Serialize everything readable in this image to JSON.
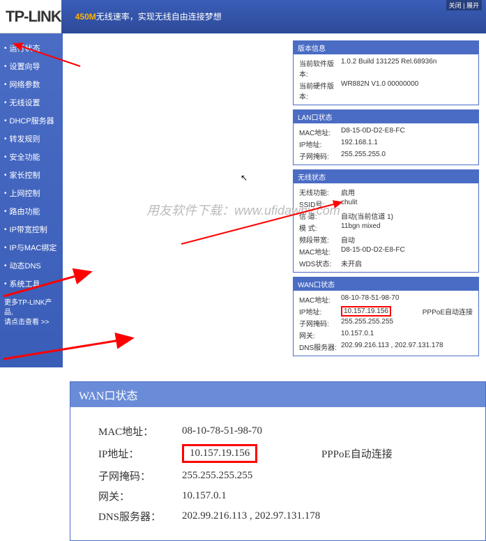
{
  "header": {
    "logo": "TP-LINK",
    "banner_highlight": "450M",
    "banner_text": "无线速率，实现无线自由连接梦想",
    "browser_menu": "关闭 | 展开"
  },
  "sidebar": {
    "items": [
      {
        "label": "运行状态"
      },
      {
        "label": "设置向导"
      },
      {
        "label": "网络参数"
      },
      {
        "label": "无线设置"
      },
      {
        "label": "DHCP服务器"
      },
      {
        "label": "转发规则"
      },
      {
        "label": "安全功能"
      },
      {
        "label": "家长控制"
      },
      {
        "label": "上网控制"
      },
      {
        "label": "路由功能"
      },
      {
        "label": "IP带宽控制"
      },
      {
        "label": "IP与MAC绑定"
      },
      {
        "label": "动态DNS"
      },
      {
        "label": "系统工具"
      }
    ],
    "footer_line1": "更多TP-LINK产品,",
    "footer_line2": "请点击查看 >>"
  },
  "panels": {
    "version": {
      "title": "版本信息",
      "rows": [
        {
          "label": "当前软件版本:",
          "value": "1.0.2 Build 131225 Rel.68936n"
        },
        {
          "label": "当前硬件版本:",
          "value": "WR882N V1.0 00000000"
        }
      ]
    },
    "lan": {
      "title": "LAN口状态",
      "rows": [
        {
          "label": "MAC地址:",
          "value": "D8-15-0D-D2-E8-FC"
        },
        {
          "label": "IP地址:",
          "value": "192.168.1.1"
        },
        {
          "label": "子网掩码:",
          "value": "255.255.255.0"
        }
      ]
    },
    "wireless": {
      "title": "无线状态",
      "rows": [
        {
          "label": "无线功能:",
          "value": "启用"
        },
        {
          "label": "SSID号:",
          "value": "chulit"
        },
        {
          "label": "信 道:",
          "value": "自动(当前信道 1)"
        },
        {
          "label": "模 式:",
          "value": "11bgn mixed"
        },
        {
          "label": "频段带宽:",
          "value": "自动"
        },
        {
          "label": "MAC地址:",
          "value": "D8-15-0D-D2-E8-FC"
        },
        {
          "label": "WDS状态:",
          "value": "未开启"
        }
      ]
    },
    "wan": {
      "title": "WAN口状态",
      "rows": [
        {
          "label": "MAC地址:",
          "value": "08-10-78-51-98-70",
          "extra": ""
        },
        {
          "label": "IP地址:",
          "value": "10.157.19.156",
          "extra": "PPPoE自动连接",
          "highlight": true
        },
        {
          "label": "子网掩码:",
          "value": "255.255.255.255",
          "extra": ""
        },
        {
          "label": "网关:",
          "value": "10.157.0.1",
          "extra": ""
        },
        {
          "label": "DNS服务器:",
          "value": "202.99.216.113 , 202.97.131.178",
          "extra": ""
        }
      ]
    }
  },
  "zoom": {
    "title": "WAN口状态",
    "rows": [
      {
        "label": "MAC地址：",
        "value": "08-10-78-51-98-70",
        "extra": ""
      },
      {
        "label": "IP地址：",
        "value": "10.157.19.156",
        "extra": "PPPoE自动连接",
        "highlight": true
      },
      {
        "label": "子网掩码：",
        "value": "255.255.255.255",
        "extra": ""
      },
      {
        "label": "网关：",
        "value": "10.157.0.1",
        "extra": ""
      },
      {
        "label": "DNS服务器：",
        "value": "202.99.216.113 , 202.97.131.178",
        "extra": ""
      }
    ]
  },
  "watermark": "用友软件下载：www.ufidawhy.com",
  "colors": {
    "primary_blue": "#4a6cc4",
    "highlight_red": "#f00",
    "accent_orange": "#ffb400"
  }
}
